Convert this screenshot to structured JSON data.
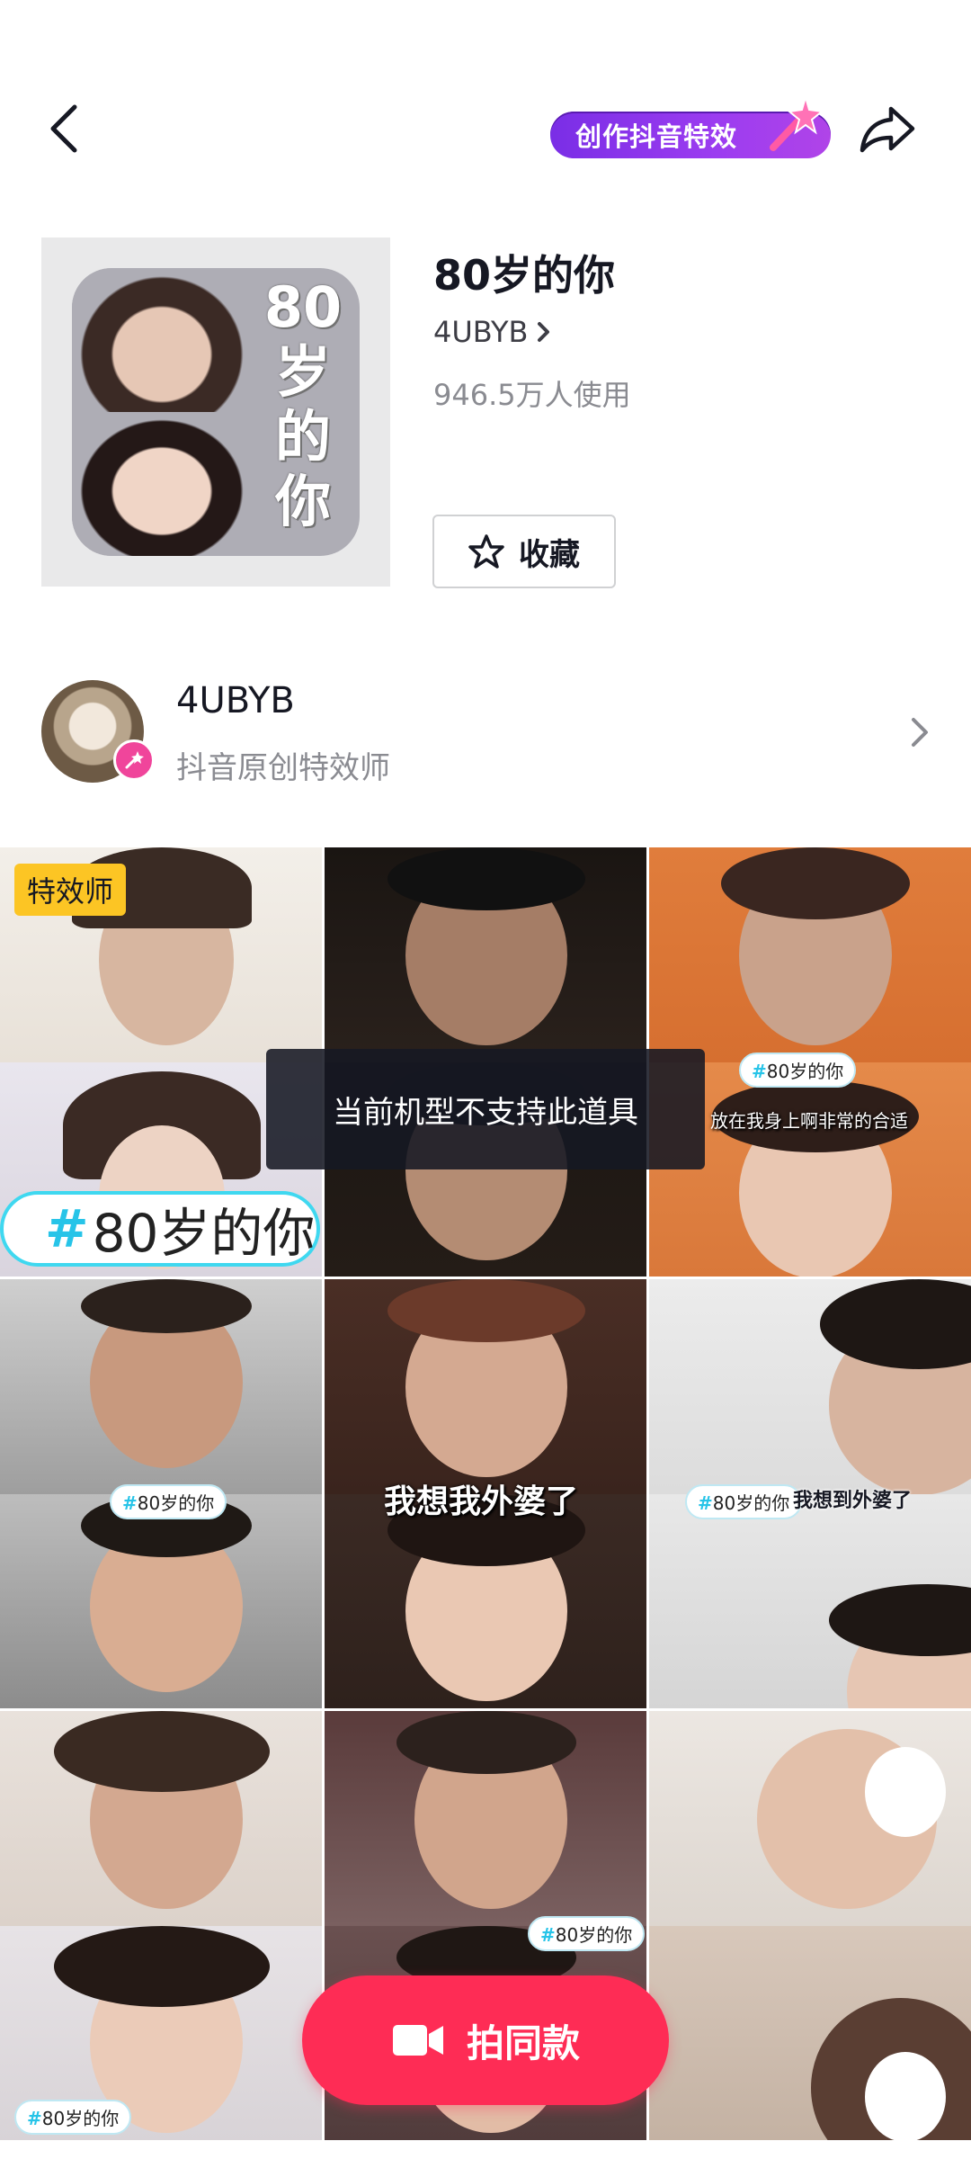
{
  "topbar": {
    "create_label": "创作抖音特效"
  },
  "effect": {
    "title": "80岁的你",
    "author": "4UBYB",
    "usage": "946.5万人使用",
    "favorite_label": "收藏",
    "thumb_text": [
      "80",
      "岁",
      "的",
      "你"
    ]
  },
  "creator": {
    "name": "4UBYB",
    "role": "抖音原创特效师"
  },
  "grid": {
    "creator_tag": "特效师",
    "big_hashtag_hash": "#",
    "big_hashtag_text": "80岁的你",
    "tag_hash": "#",
    "tag_text": "80岁的你",
    "captions": {
      "c3": "放在我身上啊非常的合适",
      "c5": "我想我外婆了",
      "c6": "我想到外婆了"
    }
  },
  "toast": "当前机型不支持此道具",
  "shoot_button": "拍同款",
  "colors": {
    "accent": "#fe2c55",
    "create_pill": "#8a34ec",
    "creator_badge": "#f0459b",
    "tag_yellow": "#fcc524",
    "hashtag_blue": "#27c4e8"
  }
}
